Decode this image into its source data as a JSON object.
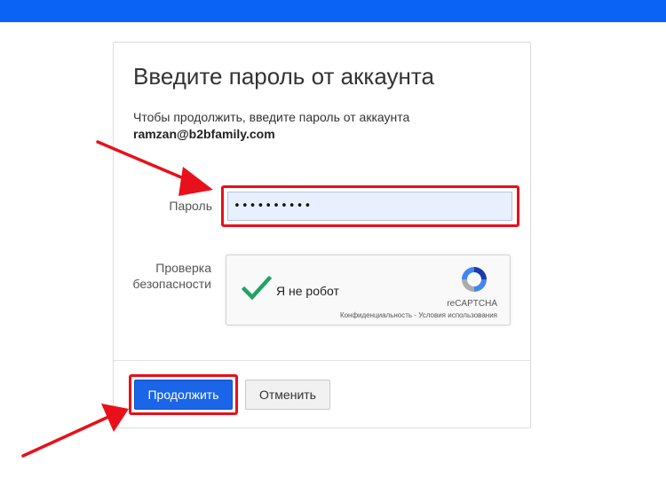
{
  "title": "Введите пароль от аккаунта",
  "subtitle": "Чтобы продолжить, введите пароль от аккаунта",
  "email": "ramzan@b2bfamily.com",
  "password": {
    "label": "Пароль",
    "value": "••••••••••"
  },
  "captcha": {
    "label_line1": "Проверка",
    "label_line2": "безопасности",
    "checkbox_text": "Я не робот",
    "brand": "reCAPTCHA",
    "links": "Конфиденциальность - Условия использования",
    "icons": [
      "check-icon",
      "recaptcha-logo-icon"
    ]
  },
  "buttons": {
    "submit": "Продолжить",
    "cancel": "Отменить"
  },
  "colors": {
    "top_bar": "#0a63f5",
    "primary_button": "#1a65e8",
    "highlight": "#e8101a",
    "check": "#1fa463"
  }
}
